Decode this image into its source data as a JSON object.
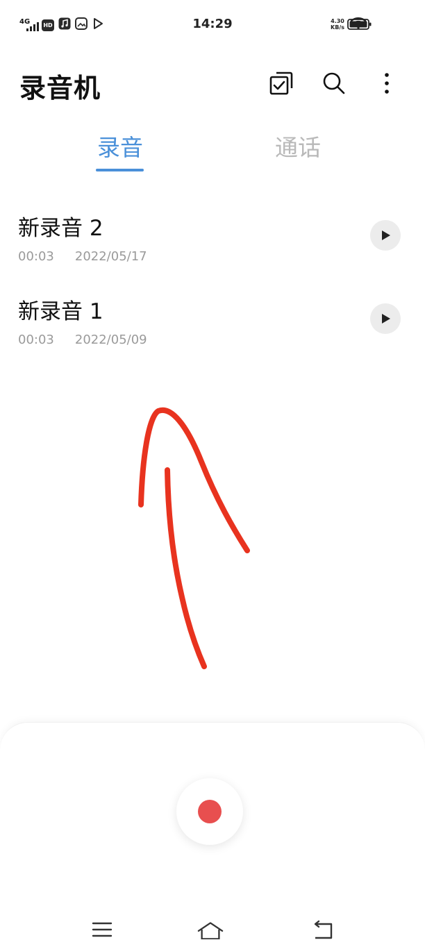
{
  "status_bar": {
    "network": "4G",
    "badge_hd": "HD",
    "time": "14:29",
    "speed_value": "4.30",
    "speed_unit": "KB/s",
    "icons": [
      "signal-icon",
      "hd-icon",
      "music-icon",
      "gallery-icon",
      "play-store-icon",
      "wifi-icon",
      "battery-icon"
    ]
  },
  "header": {
    "title": "录音机",
    "actions": [
      "select-icon",
      "search-icon",
      "more-icon"
    ]
  },
  "tabs": [
    {
      "label": "录音",
      "active": true
    },
    {
      "label": "通话",
      "active": false
    }
  ],
  "recordings": [
    {
      "name": "新录音 2",
      "duration": "00:03",
      "date": "2022/05/17"
    },
    {
      "name": "新录音 1",
      "duration": "00:03",
      "date": "2022/05/09"
    }
  ],
  "colors": {
    "accent": "#4a90d9",
    "record": "#e84f4f",
    "annotation": "#e8331f",
    "inactive_tab": "#b9b9b9",
    "meta_text": "#9a9a9a"
  },
  "nav_bar": [
    "menu-icon",
    "home-icon",
    "back-icon"
  ]
}
